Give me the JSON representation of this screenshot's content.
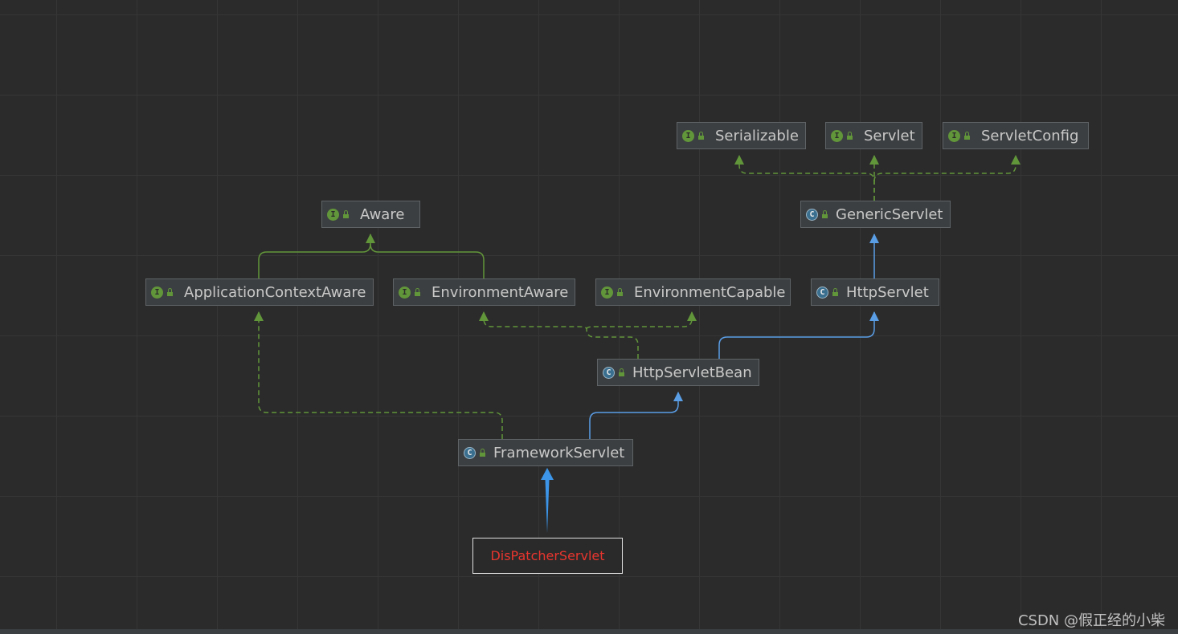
{
  "nodes": {
    "serializable": {
      "kind": "I",
      "label": "Serializable"
    },
    "servlet": {
      "kind": "I",
      "label": "Servlet"
    },
    "servlet_config": {
      "kind": "I",
      "label": "ServletConfig"
    },
    "generic_servlet": {
      "kind": "C",
      "label": "GenericServlet"
    },
    "aware": {
      "kind": "I",
      "label": "Aware"
    },
    "application_context_aware": {
      "kind": "I",
      "label": "ApplicationContextAware"
    },
    "environment_aware": {
      "kind": "I",
      "label": "EnvironmentAware"
    },
    "environment_capable": {
      "kind": "I",
      "label": "EnvironmentCapable"
    },
    "http_servlet": {
      "kind": "C",
      "label": "HttpServlet"
    },
    "http_servlet_bean": {
      "kind": "C",
      "label": "HttpServletBean"
    },
    "framework_servlet": {
      "kind": "C",
      "label": "FrameworkServlet"
    }
  },
  "annotation": {
    "label": "DisPatcherServlet",
    "color": "#e8352e"
  },
  "watermark": "CSDN @假正经的小柴",
  "colors": {
    "implements": "#62963a",
    "extends": "#5a9ee6",
    "highlight_arrow": "#3c95e8"
  }
}
